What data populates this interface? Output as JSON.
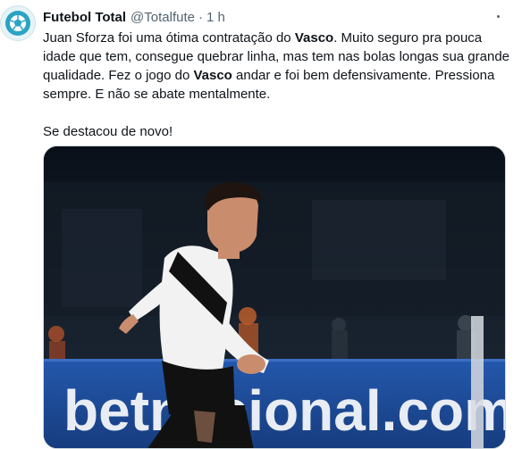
{
  "tweet": {
    "display_name": "Futebol Total",
    "handle": "@Totalfute",
    "separator": "·",
    "timestamp": "1 h",
    "avatar_icon": "ball-logo-icon",
    "more_icon": "more-options-icon",
    "text": {
      "p1_a": "Juan Sforza foi uma ótima contratação do ",
      "p1_b": "Vasco",
      "p1_c": ". Muito seguro pra pouca idade que tem, consegue quebrar linha, mas tem nas bolas longas sua grande qualidade. Fez o jogo do ",
      "p1_d": "Vasco",
      "p1_e": " andar e foi bem defensivamente. Pressiona sempre. E não se abate mentalmente.",
      "p2": "Se destacou de novo!"
    },
    "media": {
      "board_text": "betnacional.com",
      "accent_color": "#1d4fa0"
    }
  }
}
